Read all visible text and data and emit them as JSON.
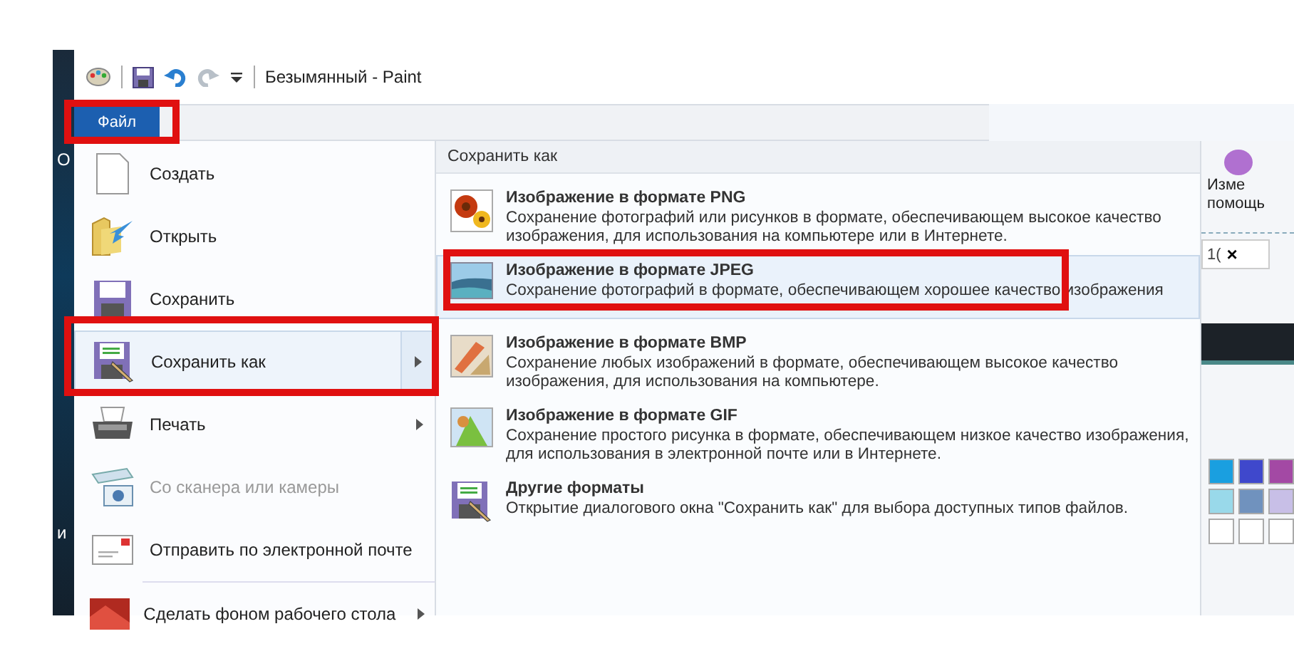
{
  "window": {
    "title": "Безымянный - Paint"
  },
  "file_tab": {
    "label": "Файл",
    "selected": true
  },
  "menu_items": [
    {
      "label": "Создать",
      "kind": "new",
      "selected": false,
      "disabled": false,
      "submenu": false
    },
    {
      "label": "Открыть",
      "kind": "open",
      "selected": false,
      "disabled": false,
      "submenu": false
    },
    {
      "label": "Сохранить",
      "kind": "save",
      "selected": false,
      "disabled": false,
      "submenu": false
    },
    {
      "label": "Сохранить как",
      "kind": "saveas",
      "selected": true,
      "disabled": false,
      "submenu": true
    },
    {
      "label": "Печать",
      "kind": "print",
      "selected": false,
      "disabled": false,
      "submenu": true
    },
    {
      "label": "Со сканера или камеры",
      "kind": "scanner",
      "selected": false,
      "disabled": true,
      "submenu": false
    },
    {
      "label": "Отправить по электронной почте",
      "kind": "mail",
      "selected": false,
      "disabled": false,
      "submenu": false
    },
    {
      "label": "Сделать фоном рабочего стола",
      "kind": "desktop",
      "selected": false,
      "disabled": false,
      "submenu": true
    }
  ],
  "submenu": {
    "title": "Сохранить как",
    "items": [
      {
        "title": "Изображение в формате PNG",
        "description": "Сохранение фотографий или рисунков в формате, обеспечивающем высокое качество изображения, для использования на компьютере или в Интернете.",
        "kind": "png",
        "selected": false
      },
      {
        "title": "Изображение в формате JPEG",
        "description": "Сохранение фотографий в формате, обеспечивающем хорошее качество изображения",
        "kind": "jpeg",
        "selected": true
      },
      {
        "title": "Изображение в формате BMP",
        "description": "Сохранение любых изображений в формате, обеспечивающем высокое качество изображения, для использования на компьютере.",
        "kind": "bmp",
        "selected": false
      },
      {
        "title": "Изображение в формате GIF",
        "description": "Сохранение простого рисунка в формате, обеспечивающем низкое качество изображения, для использования в электронной почте или в Интернете.",
        "kind": "gif",
        "selected": false
      },
      {
        "title": "Другие форматы",
        "description": "Открытие диалогового окна \"Сохранить как\" для выбора доступных типов файлов.",
        "kind": "other",
        "selected": false
      }
    ]
  },
  "ribbon": {
    "button_lines": [
      "Изме",
      "помощь"
    ],
    "tab_label": "1(",
    "tab_close": "×"
  },
  "palette": [
    {
      "color": "#1a9fe0"
    },
    {
      "color": "#3f48cc"
    },
    {
      "color": "#a349a4"
    },
    {
      "color": "#99d9ea"
    },
    {
      "color": "#7092be"
    },
    {
      "color": "#c8bfe7"
    },
    {
      "color": "#ffffff"
    },
    {
      "color": "#ffffff"
    },
    {
      "color": "#ffffff"
    }
  ],
  "background_letters": [
    "О",
    "и"
  ]
}
